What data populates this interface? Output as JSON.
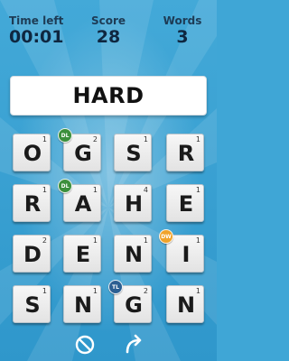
{
  "header": {
    "time_label": "Time left",
    "time_value": "00:01",
    "score_label": "Score",
    "score_value": "28",
    "words_label": "Words",
    "words_value": "3"
  },
  "current_word": "HARD",
  "board": {
    "rows": [
      [
        {
          "letter": "O",
          "points": "1",
          "bonus": ""
        },
        {
          "letter": "G",
          "points": "2",
          "bonus": "DL"
        },
        {
          "letter": "S",
          "points": "1",
          "bonus": ""
        },
        {
          "letter": "R",
          "points": "1",
          "bonus": ""
        }
      ],
      [
        {
          "letter": "R",
          "points": "1",
          "bonus": ""
        },
        {
          "letter": "A",
          "points": "1",
          "bonus": "DL"
        },
        {
          "letter": "H",
          "points": "4",
          "bonus": ""
        },
        {
          "letter": "E",
          "points": "1",
          "bonus": ""
        }
      ],
      [
        {
          "letter": "D",
          "points": "2",
          "bonus": ""
        },
        {
          "letter": "E",
          "points": "1",
          "bonus": ""
        },
        {
          "letter": "N",
          "points": "1",
          "bonus": ""
        },
        {
          "letter": "I",
          "points": "1",
          "bonus": "DW"
        }
      ],
      [
        {
          "letter": "S",
          "points": "1",
          "bonus": ""
        },
        {
          "letter": "N",
          "points": "1",
          "bonus": ""
        },
        {
          "letter": "G",
          "points": "2",
          "bonus": "TL"
        },
        {
          "letter": "N",
          "points": "1",
          "bonus": ""
        }
      ]
    ]
  },
  "controls": {
    "clear_icon": "prohibit-icon",
    "submit_icon": "curved-arrow-icon"
  },
  "colors": {
    "background": "#3fa6d6",
    "dl_badge": "#3c8f3c",
    "dw_badge": "#f0a32a",
    "tl_badge": "#2c5f92"
  }
}
